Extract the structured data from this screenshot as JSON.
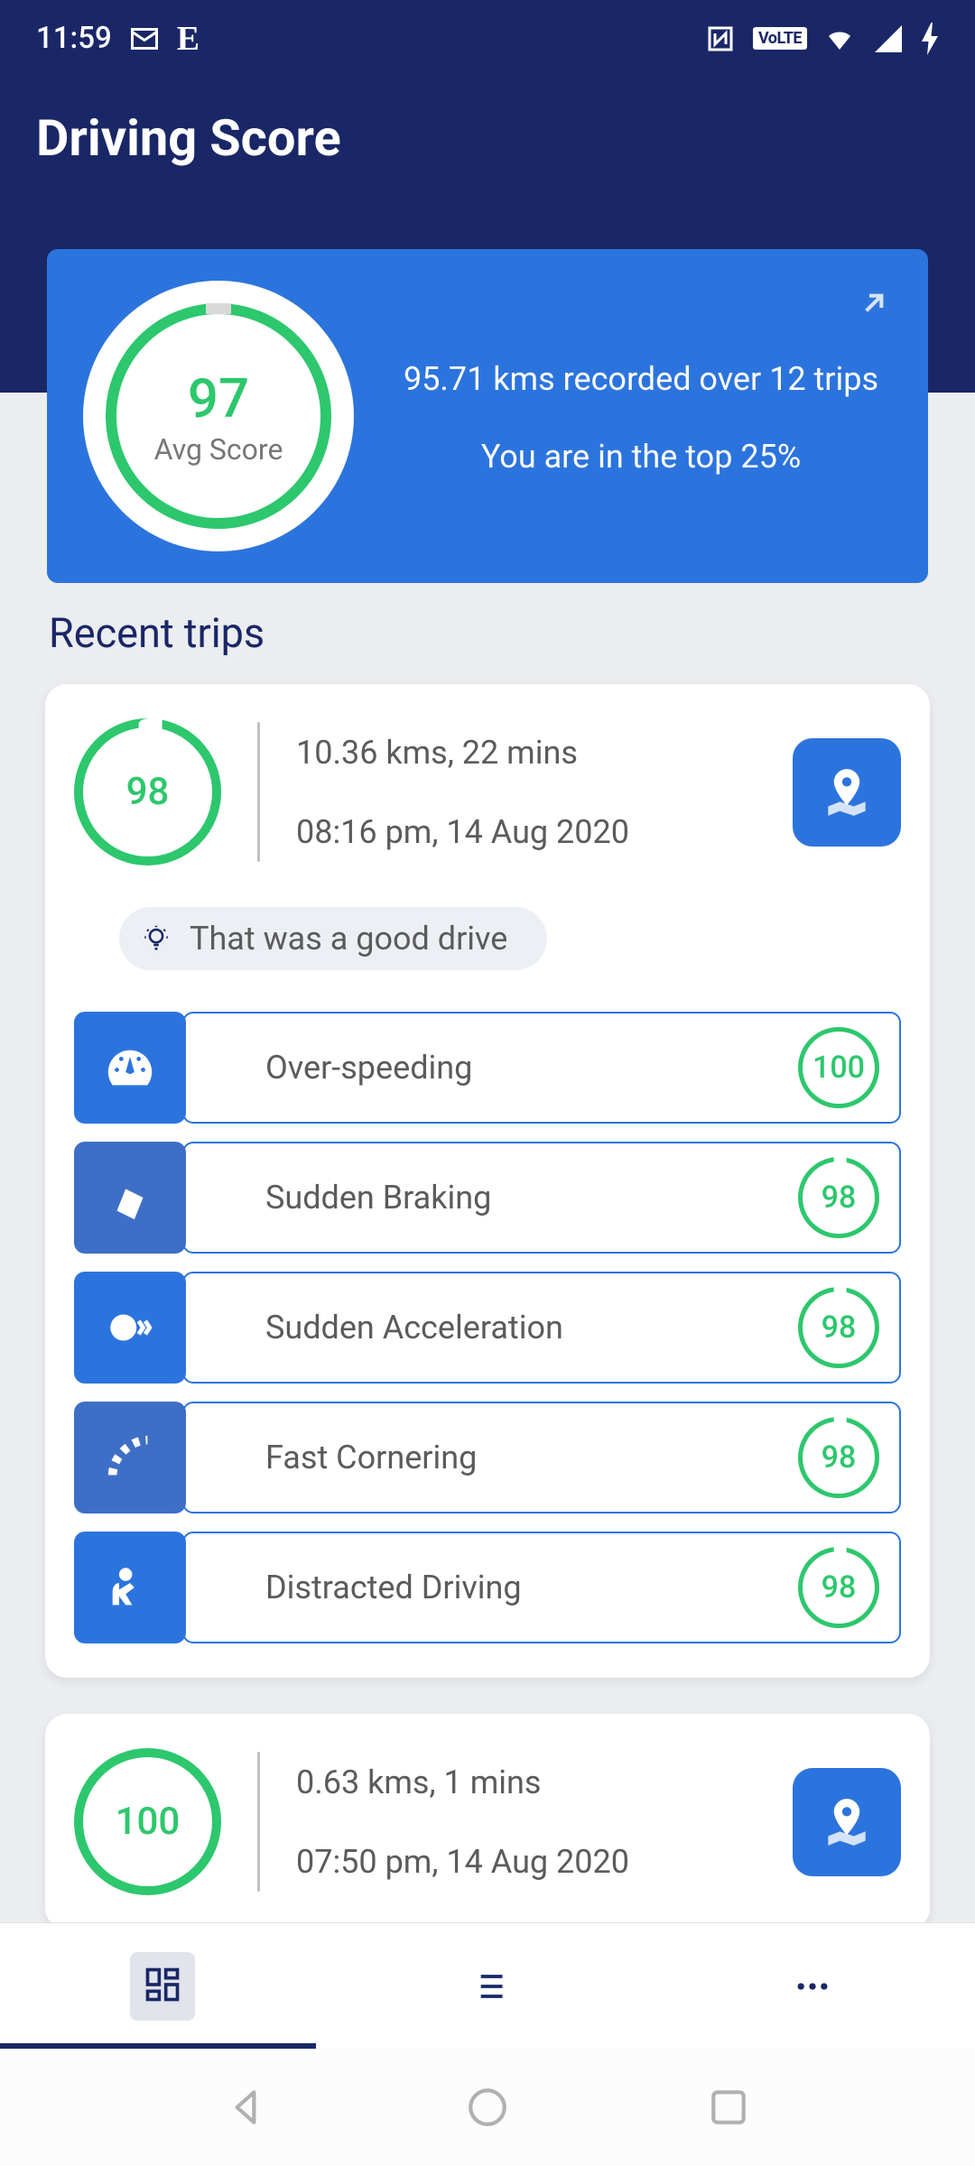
{
  "statusbar": {
    "time": "11:59"
  },
  "header": {
    "title": "Driving Score"
  },
  "summary": {
    "score": "97",
    "score_label": "Avg Score",
    "line1": "95.71 kms recorded over 12 trips",
    "line2": "You are in the top 25%"
  },
  "section": {
    "recent_trips": "Recent trips"
  },
  "trips": [
    {
      "score": "98",
      "distance_time": "10.36 kms, 22 mins",
      "timestamp": "08:16 pm, 14 Aug 2020",
      "feedback": "That was a good drive",
      "metrics": [
        {
          "label": "Over-speeding",
          "score": "100"
        },
        {
          "label": "Sudden Braking",
          "score": "98"
        },
        {
          "label": "Sudden Acceleration",
          "score": "98"
        },
        {
          "label": "Fast Cornering",
          "score": "98"
        },
        {
          "label": "Distracted Driving",
          "score": "98"
        }
      ]
    },
    {
      "score": "100",
      "distance_time": "0.63 kms, 1 mins",
      "timestamp": "07:50 pm, 14 Aug 2020"
    }
  ]
}
